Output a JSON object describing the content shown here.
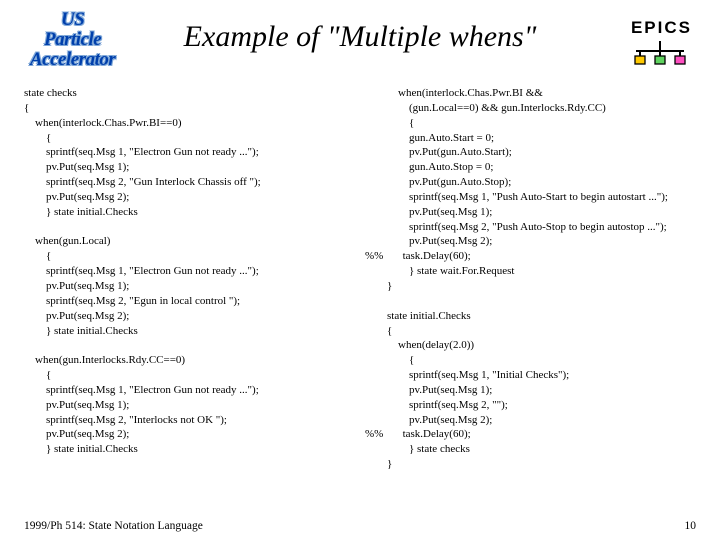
{
  "header": {
    "logo_line1": "US",
    "logo_line2": "Particle",
    "logo_line3": "Accelerator",
    "title": "Example of \"Multiple whens\"",
    "brand": "EPICS"
  },
  "code": {
    "left": "state checks\n{\n    when(interlock.Chas.Pwr.BI==0)\n        {\n        sprintf(seq.Msg 1, \"Electron Gun not ready ...\");\n        pv.Put(seq.Msg 1);\n        sprintf(seq.Msg 2, \"Gun Interlock Chassis off \");\n        pv.Put(seq.Msg 2);\n        } state initial.Checks\n\n    when(gun.Local)\n        {\n        sprintf(seq.Msg 1, \"Electron Gun not ready ...\");\n        pv.Put(seq.Msg 1);\n        sprintf(seq.Msg 2, \"Egun in local control \");\n        pv.Put(seq.Msg 2);\n        } state initial.Checks\n\n    when(gun.Interlocks.Rdy.CC==0)\n        {\n        sprintf(seq.Msg 1, \"Electron Gun not ready ...\");\n        pv.Put(seq.Msg 1);\n        sprintf(seq.Msg 2, \"Interlocks not OK \");\n        pv.Put(seq.Msg 2);\n        } state initial.Checks",
    "right": "            when(interlock.Chas.Pwr.BI &&\n                (gun.Local==0) && gun.Interlocks.Rdy.CC)\n                {\n                gun.Auto.Start = 0;\n                pv.Put(gun.Auto.Start);\n                gun.Auto.Stop = 0;\n                pv.Put(gun.Auto.Stop);\n                sprintf(seq.Msg 1, \"Push Auto-Start to begin autostart ...\");\n                pv.Put(seq.Msg 1);\n                sprintf(seq.Msg 2, \"Push Auto-Stop to begin autostop ...\");\n                pv.Put(seq.Msg 2);\n%%       task.Delay(60);\n                } state wait.For.Request\n        }\n\n        state initial.Checks\n        {\n            when(delay(2.0))\n                {\n                sprintf(seq.Msg 1, \"Initial Checks\");\n                pv.Put(seq.Msg 1);\n                sprintf(seq.Msg 2, \"\");\n                pv.Put(seq.Msg 2);\n%%       task.Delay(60);\n                } state checks\n        }"
  },
  "footer": {
    "text": "1999/Ph 514: State Notation Language",
    "page": "10"
  }
}
